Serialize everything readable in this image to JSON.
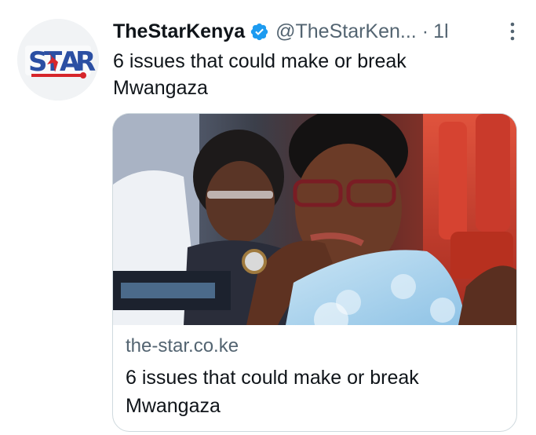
{
  "tweet": {
    "display_name": "TheStarKenya",
    "handle": "@TheStarKen...",
    "separator": "·",
    "time": "1h",
    "text": "6 issues that could make or break Mwangaza",
    "avatar_icon": "the-star-logo",
    "verified_color": "#1d9bf0"
  },
  "card": {
    "domain": "the-star.co.ke",
    "title": "6 issues that could make or break Mwangaza",
    "image": "photo-woman-with-glasses-resting-chin-on-hand"
  },
  "colors": {
    "text": "#0f1419",
    "secondary": "#536471",
    "border": "#cfd9de"
  }
}
